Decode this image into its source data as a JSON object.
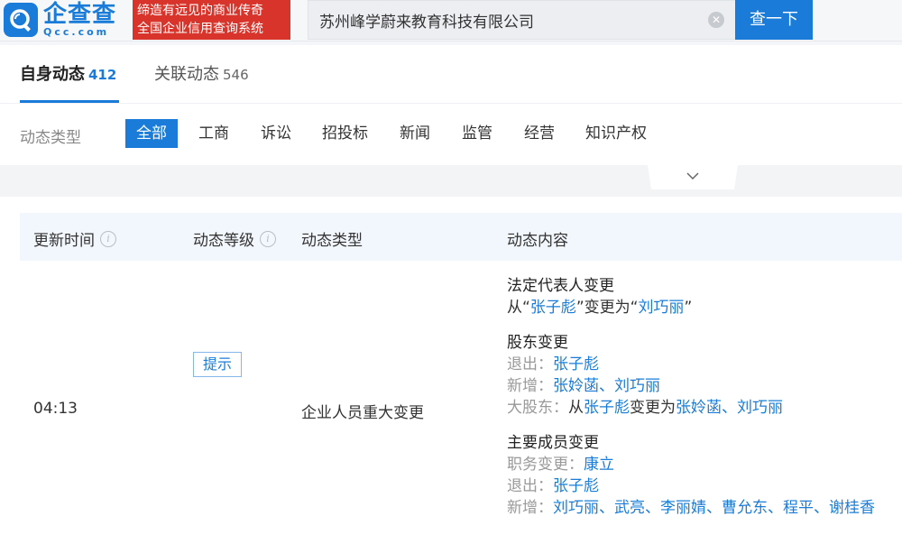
{
  "header": {
    "logo_cn": "企查查",
    "logo_en": "Qcc.com",
    "slogan_line1": "缔造有远见的商业传奇",
    "slogan_line2": "全国企业信用查询系统",
    "search_value": "苏州峰学蔚来教育科技有限公司",
    "search_button": "查一下",
    "brand_color": "#1a7cd8",
    "slogan_color": "#d9342b"
  },
  "tabs": [
    {
      "label": "自身动态",
      "count": "412"
    },
    {
      "label": "关联动态",
      "count": "546"
    }
  ],
  "filter": {
    "label": "动态类型",
    "items": [
      "全部",
      "工商",
      "诉讼",
      "招投标",
      "新闻",
      "监管",
      "经营",
      "知识产权"
    ]
  },
  "table": {
    "columns": [
      "更新时间",
      "动态等级",
      "动态类型",
      "动态内容"
    ],
    "row": {
      "time": "04:13",
      "level": "提示",
      "type": "企业人员重大变更",
      "content": {
        "legal_rep": {
          "title": "法定代表人变更",
          "from_prefix": "从“",
          "from_name": "张子彪",
          "mid": "”变更为“",
          "to_name": "刘巧丽",
          "suffix": "”"
        },
        "shareholder": {
          "title": "股东变更",
          "exit_label": "退出：",
          "exit_names": [
            "张子彪"
          ],
          "add_label": "新增：",
          "add_names": [
            "张姈菡",
            "刘巧丽"
          ],
          "major_label": "大股东：",
          "major_from_prefix": "从",
          "major_from": "张子彪",
          "major_mid": "变更为",
          "major_to": [
            "张姈菡",
            "刘巧丽"
          ]
        },
        "members": {
          "title": "主要成员变更",
          "duty_label": "职务变更：",
          "duty_names": [
            "康立"
          ],
          "exit_label": "退出：",
          "exit_names": [
            "张子彪"
          ],
          "add_label": "新增：",
          "add_names": [
            "刘巧丽",
            "武亮",
            "李丽婧",
            "曹允东",
            "程平",
            "谢桂香"
          ]
        },
        "separator": "、"
      }
    }
  }
}
